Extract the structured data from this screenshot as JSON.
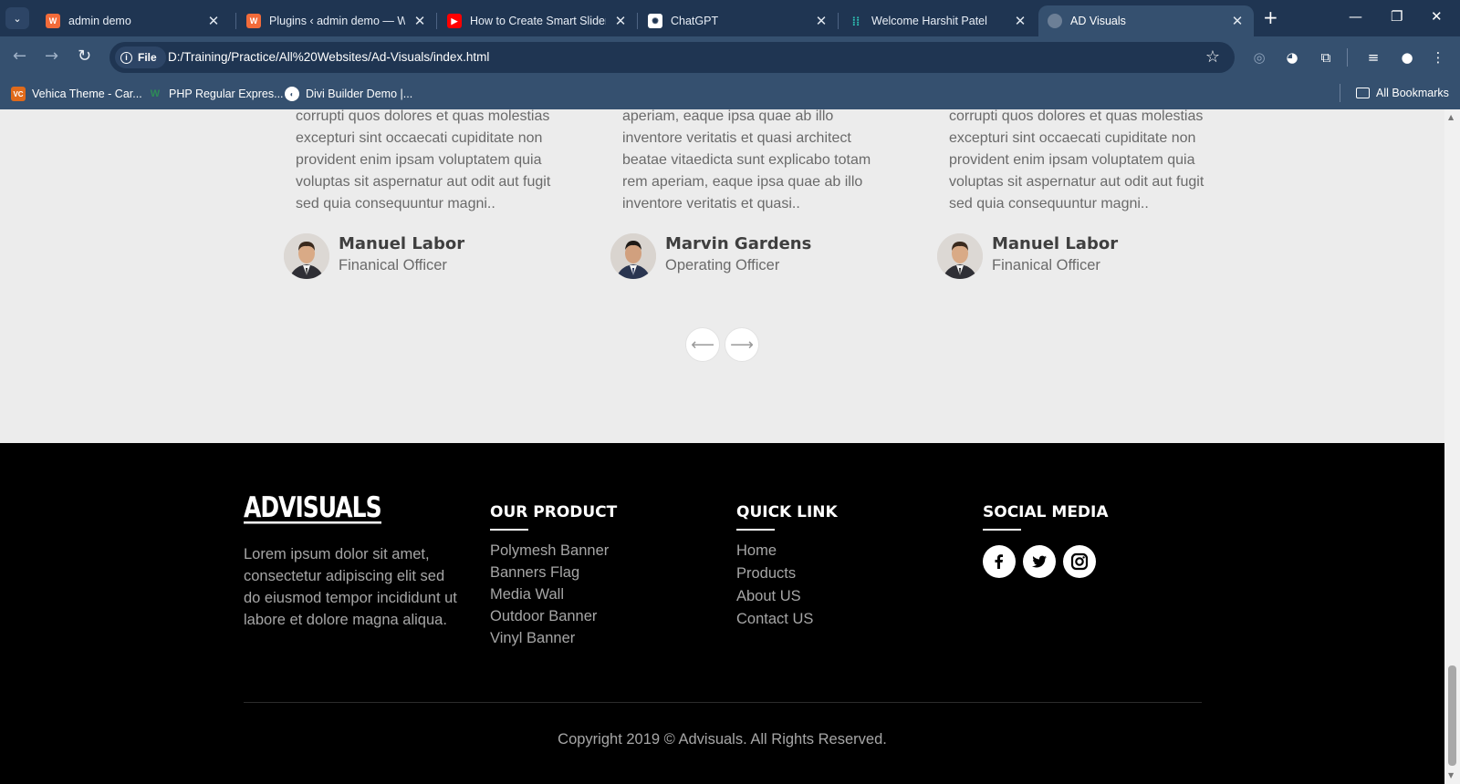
{
  "browser": {
    "tabs": [
      {
        "title": "admin demo",
        "favicon_color": "#f26b3a",
        "favicon_glyph": "W"
      },
      {
        "title": "Plugins ‹ admin demo — Wo",
        "favicon_color": "#f26b3a",
        "favicon_glyph": "W"
      },
      {
        "title": "How to Create Smart Slider i",
        "favicon_color": "#ff0000",
        "favicon_glyph": "▶"
      },
      {
        "title": "ChatGPT",
        "favicon_color": "#ffffff",
        "favicon_glyph": "✺"
      },
      {
        "title": "Welcome Harshit Patel",
        "favicon_color": "#2ec4b6",
        "favicon_glyph": "⁞"
      },
      {
        "title": "AD Visuals",
        "favicon_color": "#6c7f96",
        "favicon_glyph": "◍"
      }
    ],
    "scheme_label": "File",
    "url": "D:/Training/Practice/All%20Websites/Ad-Visuals/index.html",
    "bookmarks": [
      {
        "label": "Vehica Theme - Car...",
        "color": "#e06a1b",
        "glyph": "VC"
      },
      {
        "label": "PHP Regular Expres...",
        "color": "#2e8b57",
        "glyph": "W"
      },
      {
        "label": "Divi Builder Demo |...",
        "color": "#ffffff",
        "glyph": "◐"
      }
    ],
    "all_bookmarks_label": "All Bookmarks"
  },
  "testimonials": [
    {
      "quote": "corrupti quos dolores et quas molestias excepturi sint occaecati cupiditate non provident enim ipsam voluptatem quia voluptas sit aspernatur aut odit aut fugit sed quia consequuntur magni..",
      "name": "Manuel Labor",
      "role": "Finanical Officer"
    },
    {
      "quote": "aperiam, eaque ipsa quae ab illo inventore veritatis et quasi architect beatae vitaedicta sunt explicabo totam rem aperiam, eaque ipsa quae ab illo inventore veritatis et quasi..",
      "name": "Marvin Gardens",
      "role": "Operating Officer"
    },
    {
      "quote": "corrupti quos dolores et quas molestias excepturi sint occaecati cupiditate non provident enim ipsam voluptatem quia voluptas sit aspernatur aut odit aut fugit sed quia consequuntur magni..",
      "name": "Manuel Labor",
      "role": "Finanical Officer"
    }
  ],
  "slider": {
    "prev_glyph": "⟵",
    "next_glyph": "⟶"
  },
  "footer": {
    "logo": "ADVISUALS",
    "about": "Lorem ipsum dolor sit amet, consectetur adipiscing elit sed do eiusmod tempor incididunt ut labore et dolore magna aliqua.",
    "product_title": "OUR PRODUCT",
    "products": [
      "Polymesh Banner",
      "Banners Flag",
      "Media Wall",
      "Outdoor Banner",
      "Vinyl Banner"
    ],
    "quick_title": "QUICK LINK",
    "quick_links": [
      "Home",
      "Products",
      "About US",
      "Contact US"
    ],
    "social_title": "SOCIAL MEDIA",
    "social": [
      {
        "icon": "facebook-icon"
      },
      {
        "icon": "twitter-icon"
      },
      {
        "icon": "instagram-icon"
      }
    ],
    "copyright": "Copyright 2019 © Advisuals. All Rights Reserved."
  }
}
